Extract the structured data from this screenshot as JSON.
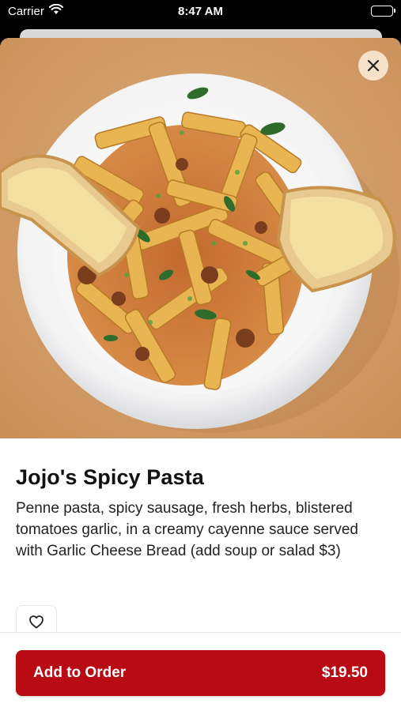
{
  "status_bar": {
    "carrier": "Carrier",
    "time": "8:47 AM"
  },
  "item": {
    "name": "Jojo's Spicy Pasta",
    "description": "Penne pasta, spicy sausage, fresh herbs, blistered tomatoes garlic, in a creamy cayenne sauce served with Garlic Cheese Bread (add soup or salad $3)",
    "image_alt": "Plate of penne pasta with garlic cheese bread"
  },
  "actions": {
    "close_icon": "close-icon",
    "favorite_icon": "heart-icon",
    "add_to_order_label": "Add to Order",
    "price": "$19.50"
  },
  "colors": {
    "accent": "#b80b13",
    "hero_background": "#d6a06b"
  }
}
